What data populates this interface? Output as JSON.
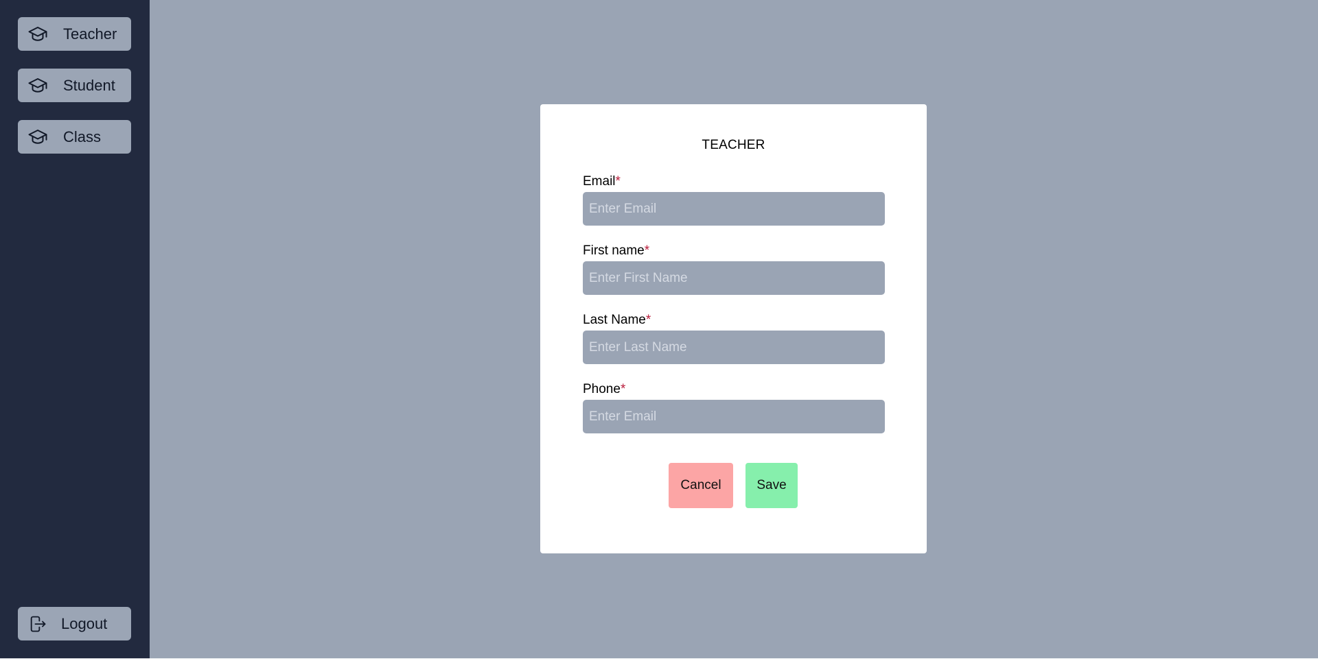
{
  "sidebar": {
    "items": [
      {
        "label": "Teacher",
        "icon": "graduation-cap-icon"
      },
      {
        "label": "Student",
        "icon": "graduation-cap-icon"
      },
      {
        "label": "Class",
        "icon": "graduation-cap-icon"
      }
    ],
    "logout": {
      "label": "Logout",
      "icon": "logout-icon"
    }
  },
  "modal": {
    "title": "TEACHER",
    "fields": [
      {
        "label": "Email",
        "required_mark": "*",
        "placeholder": "Enter Email",
        "value": ""
      },
      {
        "label": "First name",
        "required_mark": "*",
        "placeholder": "Enter First Name",
        "value": ""
      },
      {
        "label": "Last Name",
        "required_mark": "*",
        "placeholder": "Enter Last Name",
        "value": ""
      },
      {
        "label": "Phone",
        "required_mark": "*",
        "placeholder": "Enter Email",
        "value": ""
      }
    ],
    "cancel_label": "Cancel",
    "save_label": "Save"
  },
  "colors": {
    "sidebar_bg": "#222a3f",
    "main_bg": "#9aa4b4",
    "cancel_bg": "#fca5a5",
    "save_bg": "#86efac",
    "required": "#b91c3b"
  }
}
